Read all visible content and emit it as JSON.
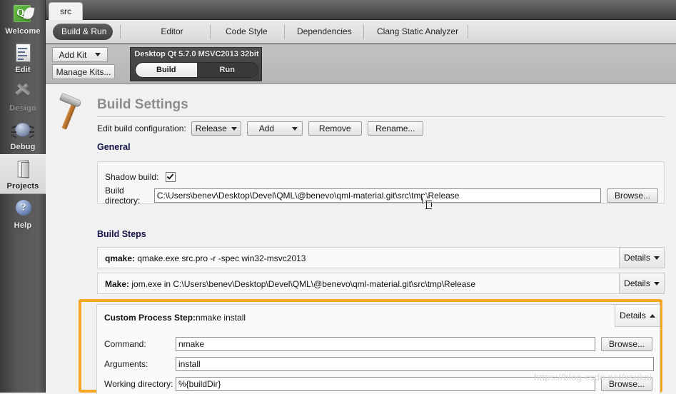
{
  "modebar": {
    "items": [
      {
        "label": "Welcome",
        "icon": "qt-logo-icon",
        "state": "normal"
      },
      {
        "label": "Edit",
        "icon": "document-edit-icon",
        "state": "normal"
      },
      {
        "label": "Design",
        "icon": "design-brush-icon",
        "state": "disabled"
      },
      {
        "label": "Debug",
        "icon": "bug-icon",
        "state": "normal"
      },
      {
        "label": "Projects",
        "icon": "projects-folder-icon",
        "state": "active"
      },
      {
        "label": "Help",
        "icon": "help-question-icon",
        "state": "normal"
      }
    ]
  },
  "tabstrip": {
    "project_tab": "src"
  },
  "filter_tabs": [
    {
      "label": "Build & Run",
      "selected": true
    },
    {
      "label": "Editor",
      "selected": false
    },
    {
      "label": "Code Style",
      "selected": false
    },
    {
      "label": "Dependencies",
      "selected": false
    },
    {
      "label": "Clang Static Analyzer",
      "selected": false
    }
  ],
  "kitbar": {
    "add_kit": "Add Kit",
    "manage_kits": "Manage Kits...",
    "kit_name": "Desktop Qt 5.7.0 MSVC2013 32bit",
    "build_tab": "Build",
    "run_tab": "Run",
    "selected_tab": "Build"
  },
  "page": {
    "title": "Build Settings",
    "config_label": "Edit build configuration:",
    "config_value": "Release",
    "add_label": "Add",
    "remove_label": "Remove",
    "rename_label": "Rename..."
  },
  "general": {
    "header": "General",
    "shadow_build_label": "Shadow build:",
    "shadow_build_checked": true,
    "build_directory_label": "Build directory:",
    "build_directory_value": "C:\\Users\\benev\\Desktop\\Devel\\QML\\@benevo\\qml-material.git\\src\\tmp\\Release",
    "browse_label": "Browse..."
  },
  "build_steps": {
    "header": "Build Steps",
    "details_label": "Details",
    "steps": [
      {
        "name": "qmake:",
        "summary": "qmake.exe src.pro -r -spec win32-msvc2013",
        "expanded": false
      },
      {
        "name": "Make:",
        "summary": "jom.exe in C:\\Users\\benev\\Desktop\\Devel\\QML\\@benevo\\qml-material.git\\src\\tmp\\Release",
        "expanded": false
      }
    ],
    "custom_step": {
      "name": "Custom Process Step:",
      "summary": "nmake install",
      "expanded": true,
      "details_label": "Details",
      "command_label": "Command:",
      "command_value": "nmake",
      "arguments_label": "Arguments:",
      "arguments_value": "install",
      "working_directory_label": "Working directory:",
      "working_directory_value": "%{buildDir}",
      "browse_label": "Browse..."
    }
  },
  "watermark": {
    "text": "https://blog.csdn.net/xsukai"
  },
  "colors": {
    "highlight": "#f5a623",
    "accent_header": "#14144a",
    "title": "#8d8d8d"
  }
}
